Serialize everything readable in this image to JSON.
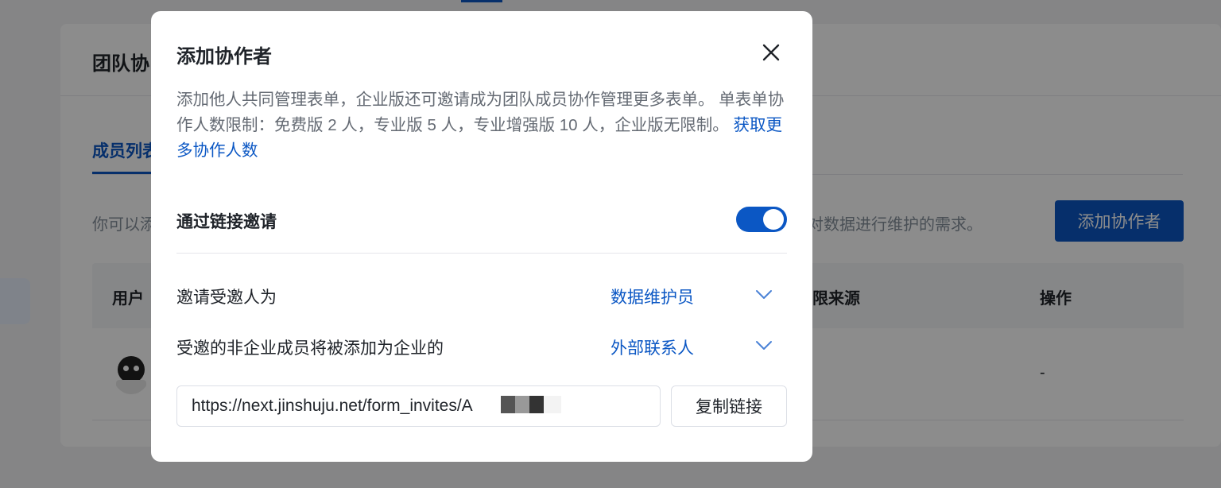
{
  "background": {
    "section_title": "团队协",
    "tab_label": "成员列表",
    "desc_left": "你可以添",
    "desc_right": "对数据进行维护的需求。",
    "add_button": "添加协作者",
    "table_headers": [
      "用户",
      "权限来源",
      "操作"
    ],
    "row_action": "-"
  },
  "modal": {
    "title": "添加协作者",
    "description": "添加他人共同管理表单，企业版还可邀请成为团队成员协作管理更多表单。 单表单协作人数限制：免费版 2 人，专业版 5 人，专业增强版 10 人，企业版无限制。",
    "more_link": "获取更多协作人数",
    "invite_by_link": {
      "label": "通过链接邀请",
      "enabled": true
    },
    "invite_role": {
      "label": "邀请受邀人为",
      "value": "数据维护员"
    },
    "non_member_role": {
      "label": "受邀的非企业成员将被添加为企业的",
      "value": "外部联系人"
    },
    "invite_link": "https://next.jinshuju.net/form_invites/A",
    "copy_button": "复制链接"
  },
  "icons": {
    "close": "close-icon",
    "chevron": "chevron-down-icon"
  },
  "colors": {
    "accent": "#0b57c4",
    "overlay": "rgba(0,0,0,0.45)"
  }
}
